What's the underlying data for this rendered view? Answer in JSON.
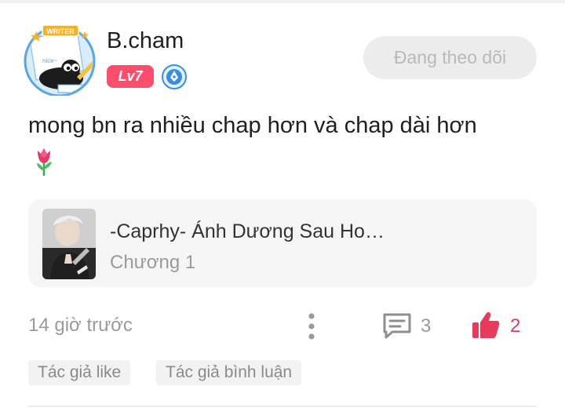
{
  "comment": {
    "author": {
      "name": "B.cham",
      "level_badge": "Lv7",
      "avatar_badge_text": "WRITER",
      "avatar_caption": "nice~",
      "level_badge_color": "#ff4d6d",
      "writer_badge_icon": "writer-pen-badge-icon",
      "avatar_icon": "cat-writer-avatar"
    },
    "follow_button_label": "Đang theo dõi",
    "text": "mong bn ra nhiều chap hơn và chap dài hơn",
    "emoji_icon": "tulip-icon",
    "chapter": {
      "title": "-Caprhy- Ánh Dương Sau Ho…",
      "subtitle": "Chương 1"
    },
    "timestamp": "14 giờ trước",
    "reply_count": "3",
    "like_count": "2",
    "like_color": "#e83a5a",
    "tags": [
      "Tác giả like",
      "Tác giả bình luận"
    ]
  }
}
